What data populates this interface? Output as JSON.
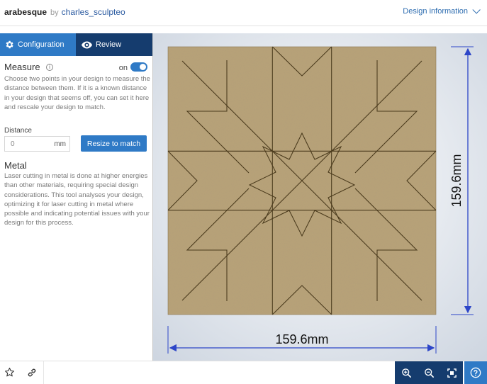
{
  "header": {
    "design_name": "arabesque",
    "by_label": "by",
    "author": "charles_sculpteo",
    "design_info_label": "Design information"
  },
  "tabs": [
    {
      "label": "Configuration",
      "icon": "gear-icon"
    },
    {
      "label": "Review",
      "icon": "eye-icon"
    }
  ],
  "measure": {
    "title": "Measure",
    "toggle_label": "on",
    "description": "Choose two points in your design to measure the distance between them. If it is a known distance in your design that seems off, you can set it here and rescale your design to match.",
    "distance_label": "Distance",
    "distance_placeholder": "0",
    "distance_unit": "mm",
    "resize_button": "Resize to match"
  },
  "metal": {
    "title": "Metal",
    "description": "Laser cutting in metal is done at higher energies than other materials, requiring special design considerations. This tool analyses your design, optimizing it for laser cutting in metal where possible and indicating potential issues with your design for this process."
  },
  "viewer": {
    "width_dimension": "159.6mm",
    "height_dimension": "159.6mm",
    "material_color": "#b9a277",
    "dimension_color": "#2d46c8"
  },
  "toolbar": {
    "left_icons": [
      "star-icon",
      "link-icon"
    ],
    "zoom_icons": [
      "zoom-in-icon",
      "zoom-out-icon",
      "fit-screen-icon"
    ],
    "help_icon": "help-icon"
  },
  "colors": {
    "accent": "#2f7ac6",
    "dark_nav": "#153c6e",
    "link": "#2e6db0"
  }
}
